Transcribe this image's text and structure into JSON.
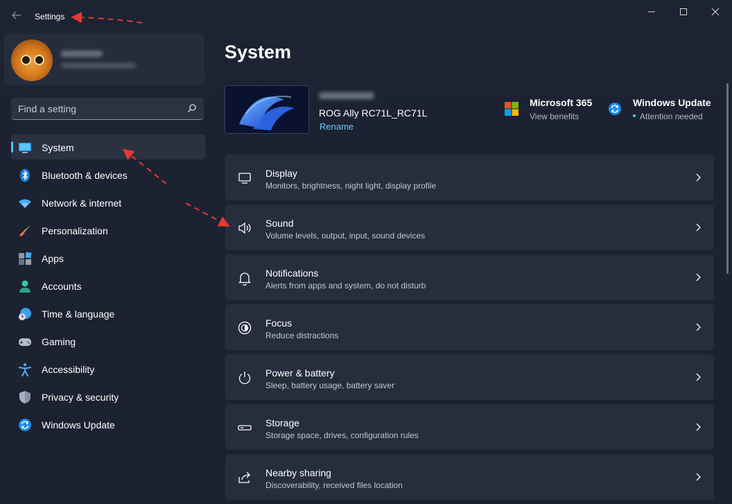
{
  "window": {
    "title": "Settings",
    "controls": [
      "minimize",
      "maximize",
      "close"
    ]
  },
  "profile": {
    "name": "",
    "email": ""
  },
  "search": {
    "placeholder": "Find a setting"
  },
  "sidebar": {
    "items": [
      {
        "label": "System",
        "icon": "monitor-icon",
        "active": true
      },
      {
        "label": "Bluetooth & devices",
        "icon": "bluetooth-icon"
      },
      {
        "label": "Network & internet",
        "icon": "wifi-icon"
      },
      {
        "label": "Personalization",
        "icon": "brush-icon"
      },
      {
        "label": "Apps",
        "icon": "apps-icon"
      },
      {
        "label": "Accounts",
        "icon": "person-icon"
      },
      {
        "label": "Time & language",
        "icon": "clock-globe-icon"
      },
      {
        "label": "Gaming",
        "icon": "gamepad-icon"
      },
      {
        "label": "Accessibility",
        "icon": "accessibility-icon"
      },
      {
        "label": "Privacy & security",
        "icon": "shield-icon"
      },
      {
        "label": "Windows Update",
        "icon": "update-icon"
      }
    ]
  },
  "main": {
    "title": "System",
    "device": {
      "name": "",
      "model": "ROG Ally RC71L_RC71L",
      "rename": "Rename"
    },
    "quick_links": [
      {
        "title": "Microsoft 365",
        "subtitle": "View benefits",
        "icon": "microsoft-logo-icon"
      },
      {
        "title": "Windows Update",
        "subtitle": "Attention needed",
        "icon": "update-icon"
      }
    ],
    "cards": [
      {
        "title": "Display",
        "subtitle": "Monitors, brightness, night light, display profile",
        "icon": "display-icon"
      },
      {
        "title": "Sound",
        "subtitle": "Volume levels, output, input, sound devices",
        "icon": "speaker-icon"
      },
      {
        "title": "Notifications",
        "subtitle": "Alerts from apps and system, do not disturb",
        "icon": "bell-icon"
      },
      {
        "title": "Focus",
        "subtitle": "Reduce distractions",
        "icon": "focus-icon"
      },
      {
        "title": "Power & battery",
        "subtitle": "Sleep, battery usage, battery saver",
        "icon": "power-icon"
      },
      {
        "title": "Storage",
        "subtitle": "Storage space, drives, configuration rules",
        "icon": "storage-icon"
      },
      {
        "title": "Nearby sharing",
        "subtitle": "Discoverability, received files location",
        "icon": "share-icon"
      }
    ]
  },
  "colors": {
    "accent": "#4cc2ff",
    "link": "#66c6ff",
    "annotation_arrow": "#e53935",
    "background": "#1c2230",
    "card": "#262d3c"
  }
}
